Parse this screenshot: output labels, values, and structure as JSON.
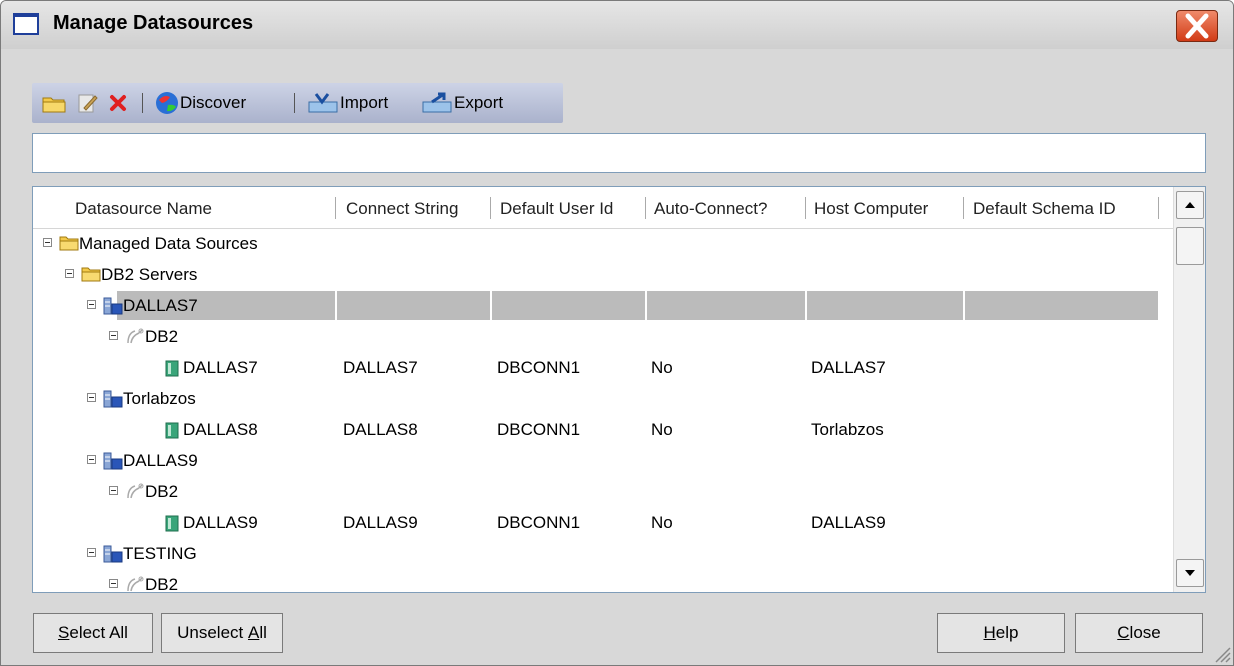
{
  "window": {
    "title": "Manage Datasources"
  },
  "toolbar": {
    "discover_label": "Discover",
    "import_label": "Import",
    "export_label": "Export"
  },
  "filter": {
    "value": ""
  },
  "columns": [
    "Datasource Name",
    "Connect String",
    "Default User Id",
    "Auto-Connect?",
    "Host Computer",
    "Default Schema ID"
  ],
  "rows": [
    {
      "name": "Managed Data Sources",
      "icon": "folder-icon",
      "expander": true
    },
    {
      "name": "DB2 Servers",
      "icon": "folder-icon",
      "expander": true
    },
    {
      "name": "DALLAS7",
      "icon": "server-icon",
      "expander": true,
      "selected": true
    },
    {
      "name": "DB2",
      "icon": "db2-node-icon",
      "expander": true
    },
    {
      "name": "DALLAS7",
      "icon": "database-icon",
      "connect": "DALLAS7",
      "user": "DBCONN1",
      "auto": "No",
      "host": "DALLAS7"
    },
    {
      "name": "Torlabzos",
      "icon": "server-icon",
      "expander": true
    },
    {
      "name": "DALLAS8",
      "icon": "database-icon",
      "connect": "DALLAS8",
      "user": "DBCONN1",
      "auto": "No",
      "host": "Torlabzos"
    },
    {
      "name": "DALLAS9",
      "icon": "server-icon",
      "expander": true
    },
    {
      "name": "DB2",
      "icon": "db2-node-icon",
      "expander": true
    },
    {
      "name": "DALLAS9",
      "icon": "database-icon",
      "connect": "DALLAS9",
      "user": "DBCONN1",
      "auto": "No",
      "host": "DALLAS9"
    },
    {
      "name": "TESTING",
      "icon": "server-icon",
      "expander": true
    },
    {
      "name": "DB2",
      "icon": "db2-node-icon",
      "expander": true
    }
  ],
  "buttons": {
    "select_all": {
      "prefix": "",
      "underline": "S",
      "rest": "elect All"
    },
    "unselect_all": {
      "prefix": "Unselect ",
      "underline": "A",
      "rest": "ll"
    },
    "help": {
      "prefix": "",
      "underline": "H",
      "rest": "elp"
    },
    "close": {
      "prefix": "",
      "underline": "C",
      "rest": "lose"
    }
  },
  "colors": {
    "selected_row": "#bbbbbb",
    "toolbar": "#b8bfd6",
    "close_button": "#d23b16"
  }
}
